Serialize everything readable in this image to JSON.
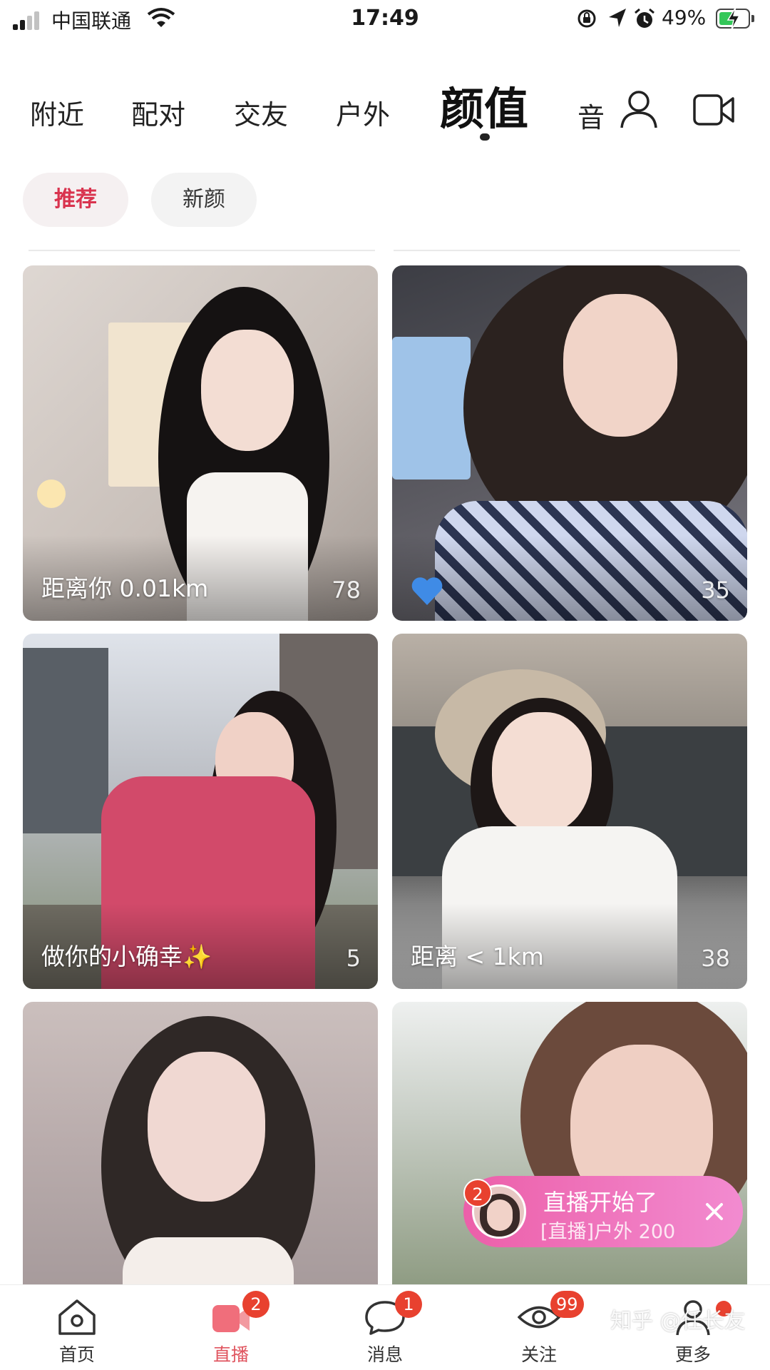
{
  "status_bar": {
    "carrier": "中国联通",
    "time": "17:49",
    "battery_percent": "49%",
    "battery_level": 0.49,
    "icons": [
      "signal-icon",
      "wifi-icon",
      "rotation-lock-icon",
      "location-arrow-icon",
      "alarm-icon",
      "battery-icon"
    ]
  },
  "top_nav": {
    "tabs": [
      "附近",
      "配对",
      "交友",
      "户外",
      "颜值"
    ],
    "active_tab": "颜值",
    "partial_tab": "音",
    "icons": [
      "profile-icon",
      "video-camera-icon"
    ]
  },
  "sub_tabs": {
    "items": [
      "推荐",
      "新颜"
    ],
    "active": "推荐",
    "active_color": "#d9344f"
  },
  "feed": {
    "cards": [
      {
        "caption": "距离你 0.01km",
        "count": "78"
      },
      {
        "caption": "",
        "count": "35",
        "icon": "blue-heart-icon"
      },
      {
        "caption": "做你的小确幸✨",
        "count": "5"
      },
      {
        "caption": "距离 < 1km",
        "count": "38"
      },
      {
        "caption": "",
        "count": ""
      },
      {
        "caption": "",
        "count": ""
      }
    ]
  },
  "live_toast": {
    "badge": "2",
    "title": "直播开始了",
    "subtitle": "[直播]户外 200"
  },
  "bottom_nav": {
    "items": [
      {
        "label": "首页",
        "icon": "home-icon"
      },
      {
        "label": "直播",
        "icon": "live-camera-icon",
        "badge": "2"
      },
      {
        "label": "消息",
        "icon": "chat-bubble-icon",
        "badge": "1"
      },
      {
        "label": "关注",
        "icon": "eye-icon",
        "badge": "99"
      },
      {
        "label": "更多",
        "icon": "person-icon",
        "dot": true
      }
    ],
    "active": "直播",
    "active_color": "#e0555f",
    "badge_color": "#e8412f"
  },
  "watermark": "知乎 @任长友"
}
